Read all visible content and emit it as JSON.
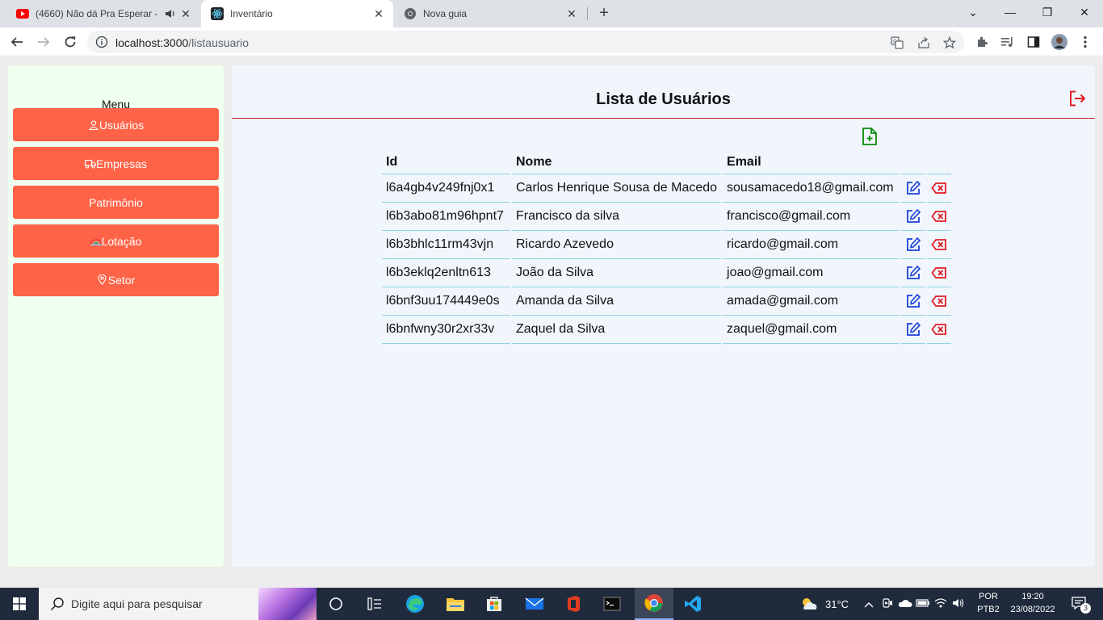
{
  "browser": {
    "tabs": [
      {
        "title": "(4660) Não dá Pra Esperar - ",
        "close": "✕"
      },
      {
        "title": "Inventário",
        "close": "✕"
      },
      {
        "title": "Nova guia",
        "close": "✕"
      }
    ],
    "new_tab": "+",
    "window_controls": {
      "dropdown": "⌄",
      "minimize": "—",
      "restore": "❐",
      "close": "✕"
    },
    "url_host": "localhost:3000",
    "url_path": "/listausuario"
  },
  "sidebar": {
    "title": "Menu",
    "items": [
      {
        "label": "Usuários",
        "icon": "user-icon"
      },
      {
        "label": "Empresas",
        "icon": "truck-icon"
      },
      {
        "label": "Patrimônio",
        "icon": ""
      },
      {
        "label": "Lotação",
        "icon": "rainbow-icon"
      },
      {
        "label": "Setor",
        "icon": "map-pin-icon"
      }
    ]
  },
  "main": {
    "title": "Lista de Usuários",
    "columns": {
      "id": "Id",
      "name": "Nome",
      "email": "Email"
    },
    "rows": [
      {
        "id": "l6a4gb4v249fnj0x1",
        "name": "Carlos Henrique Sousa de Macedo",
        "email": "sousamacedo18@gmail.com"
      },
      {
        "id": "l6b3abo81m96hpnt7",
        "name": "Francisco da silva",
        "email": "francisco@gmail.com"
      },
      {
        "id": "l6b3bhlc11rm43vjn",
        "name": "Ricardo Azevedo",
        "email": "ricardo@gmail.com"
      },
      {
        "id": "l6b3eklq2enltn613",
        "name": "João da Silva",
        "email": "joao@gmail.com"
      },
      {
        "id": "l6bnf3uu174449e0s",
        "name": "Amanda da Silva",
        "email": "amada@gmail.com"
      },
      {
        "id": "l6bnfwny30r2xr33v",
        "name": "Zaquel da Silva",
        "email": "zaquel@gmail.com"
      }
    ]
  },
  "colors": {
    "accent": "#ff6347",
    "edit_icon": "#1d3fd8",
    "delete_icon": "#e01b24",
    "add_icon": "#0a8a0a",
    "logout_icon": "#e01b24"
  },
  "taskbar": {
    "search_placeholder": "Digite aqui para pesquisar",
    "temperature": "31°C",
    "language": "POR",
    "layout": "PTB2",
    "time": "19:20",
    "date": "23/08/2022",
    "notifications": "3"
  }
}
